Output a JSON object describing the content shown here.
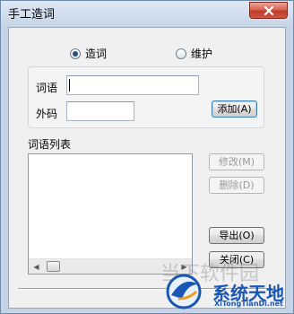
{
  "window": {
    "title": "手工造词"
  },
  "mode": {
    "options": [
      {
        "label": "造词",
        "selected": true
      },
      {
        "label": "维护",
        "selected": false
      }
    ]
  },
  "form": {
    "word_label": "词语",
    "word_value": "",
    "code_label": "外码",
    "code_value": "",
    "add_button": "添加(A)"
  },
  "list": {
    "label": "词语列表",
    "items": []
  },
  "buttons": {
    "modify": "修改(M)",
    "delete": "删除(D)",
    "export": "导出(O)",
    "close": "关闭(C)"
  },
  "watermark": {
    "faded_text": "当下软件园",
    "brand": "系统天地",
    "url": "XiTongTianDi.net"
  },
  "colors": {
    "titlebar": "#c4d3e5",
    "close_button": "#c0392b",
    "dialog_bg": "#f0f0f0",
    "brand": "#1a56b4"
  }
}
